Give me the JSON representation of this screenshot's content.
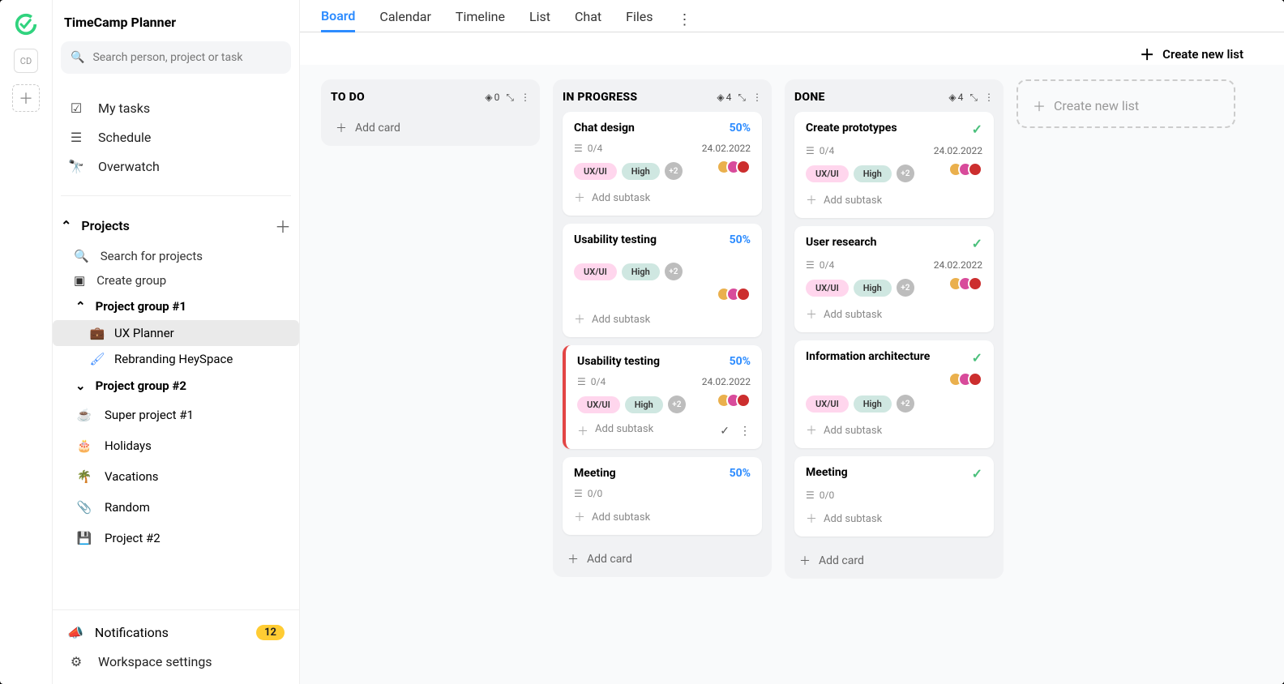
{
  "appTitle": "TimeCamp Planner",
  "userInitials": "CD",
  "search": {
    "placeholder": "Search person, project or task"
  },
  "nav": {
    "my_tasks": "My tasks",
    "schedule": "Schedule",
    "overwatch": "Overwatch",
    "projects_label": "Projects",
    "search_projects": "Search for projects",
    "create_group": "Create group",
    "group1": "Project group #1",
    "group2": "Project group #2",
    "proj_ux": "UX Planner",
    "proj_rebrand": "Rebranding HeySpace",
    "proj_super": "Super project #1",
    "proj_holidays": "Holidays",
    "proj_vacations": "Vacations",
    "proj_random": "Random",
    "proj_2": "Project #2"
  },
  "bottom": {
    "notifications": "Notifications",
    "notif_count": "12",
    "workspace_settings": "Workspace settings"
  },
  "tabs": [
    "Board",
    "Calendar",
    "Timeline",
    "List",
    "Chat",
    "Files"
  ],
  "activeTab": "Board",
  "create_new_list": "Create new list",
  "columns": {
    "todo": {
      "title": "TO DO",
      "count": "0",
      "add_card": "Add card"
    },
    "in_progress": {
      "title": "IN PROGRESS",
      "count": "4",
      "add_card": "Add card"
    },
    "done": {
      "title": "DONE",
      "count": "4",
      "add_card": "Add card"
    },
    "new": {
      "title": "Create new list"
    }
  },
  "labels": {
    "add_subtask": "Add subtask",
    "uxui": "UX/UI",
    "high": "High",
    "plus2": "+2"
  },
  "cards": {
    "ip1": {
      "title": "Chat design",
      "pct": "50%",
      "subtasks": "0/4",
      "date": "24.02.2022"
    },
    "ip2": {
      "title": "Usability testing",
      "pct": "50%"
    },
    "ip3": {
      "title": "Usability testing",
      "pct": "50%",
      "subtasks": "0/4",
      "date": "24.02.2022"
    },
    "ip4": {
      "title": "Meeting",
      "pct": "50%",
      "subtasks": "0/0"
    },
    "dn1": {
      "title": "Create prototypes",
      "subtasks": "0/4",
      "date": "24.02.2022"
    },
    "dn2": {
      "title": "User research",
      "subtasks": "0/4",
      "date": "24.02.2022"
    },
    "dn3": {
      "title": "Information architecture"
    },
    "dn4": {
      "title": "Meeting",
      "subtasks": "0/0"
    }
  }
}
